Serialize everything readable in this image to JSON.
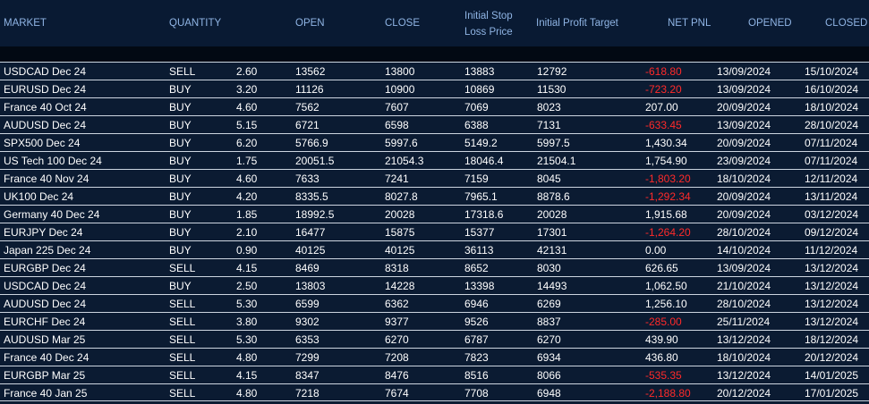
{
  "columns": {
    "market": "MARKET",
    "quantity": "QUANTITY",
    "open": "OPEN",
    "close": "CLOSE",
    "stop_line1": "Initial Stop",
    "stop_line2": "Loss Price",
    "profit": "Initial Profit Target",
    "pnl": "NET PNL",
    "opened": "OPENED",
    "closed": "CLOSED"
  },
  "colors": {
    "header_text": "#8fb4e4",
    "negative": "#ff2a2a",
    "text": "#ffffff"
  },
  "rows": [
    {
      "market": "USDCAD Dec 24",
      "side": "SELL",
      "qty": "2.60",
      "open": "13562",
      "close": "13800",
      "stop": "13883",
      "target": "12792",
      "pnl": "-618.80",
      "opened": "13/09/2024",
      "closed": "15/10/2024"
    },
    {
      "market": "EURUSD Dec 24",
      "side": "BUY",
      "qty": "3.20",
      "open": "11126",
      "close": "10900",
      "stop": "10869",
      "target": "11530",
      "pnl": "-723.20",
      "opened": "13/09/2024",
      "closed": "16/10/2024"
    },
    {
      "market": "France 40 Oct 24",
      "side": "BUY",
      "qty": "4.60",
      "open": "7562",
      "close": "7607",
      "stop": "7069",
      "target": "8023",
      "pnl": "207.00",
      "opened": "20/09/2024",
      "closed": "18/10/2024"
    },
    {
      "market": "AUDUSD Dec 24",
      "side": "BUY",
      "qty": "5.15",
      "open": "6721",
      "close": "6598",
      "stop": "6388",
      "target": "7131",
      "pnl": "-633.45",
      "opened": "13/09/2024",
      "closed": "28/10/2024"
    },
    {
      "market": "SPX500 Dec 24",
      "side": "BUY",
      "qty": "6.20",
      "open": "5766.9",
      "close": "5997.6",
      "stop": "5149.2",
      "target": "5997.5",
      "pnl": "1,430.34",
      "opened": "20/09/2024",
      "closed": "07/11/2024"
    },
    {
      "market": "US Tech 100 Dec 24",
      "side": "BUY",
      "qty": "1.75",
      "open": "20051.5",
      "close": "21054.3",
      "stop": "18046.4",
      "target": "21504.1",
      "pnl": "1,754.90",
      "opened": "23/09/2024",
      "closed": "07/11/2024"
    },
    {
      "market": "France 40 Nov 24",
      "side": "BUY",
      "qty": "4.60",
      "open": "7633",
      "close": "7241",
      "stop": "7159",
      "target": "8045",
      "pnl": "-1,803.20",
      "opened": "18/10/2024",
      "closed": "12/11/2024"
    },
    {
      "market": "UK100 Dec 24",
      "side": "BUY",
      "qty": "4.20",
      "open": "8335.5",
      "close": "8027.8",
      "stop": "7965.1",
      "target": "8878.6",
      "pnl": "-1,292.34",
      "opened": "20/09/2024",
      "closed": "13/11/2024"
    },
    {
      "market": "Germany 40 Dec 24",
      "side": "BUY",
      "qty": "1.85",
      "open": "18992.5",
      "close": "20028",
      "stop": "17318.6",
      "target": "20028",
      "pnl": "1,915.68",
      "opened": "20/09/2024",
      "closed": "03/12/2024"
    },
    {
      "market": "EURJPY Dec 24",
      "side": "BUY",
      "qty": "2.10",
      "open": "16477",
      "close": "15875",
      "stop": "15377",
      "target": "17301",
      "pnl": "-1,264.20",
      "opened": "28/10/2024",
      "closed": "09/12/2024"
    },
    {
      "market": "Japan 225 Dec 24",
      "side": "BUY",
      "qty": "0.90",
      "open": "40125",
      "close": "40125",
      "stop": "36113",
      "target": "42131",
      "pnl": "0.00",
      "opened": "14/10/2024",
      "closed": "11/12/2024"
    },
    {
      "market": "EURGBP Dec 24",
      "side": "SELL",
      "qty": "4.15",
      "open": "8469",
      "close": "8318",
      "stop": "8652",
      "target": "8030",
      "pnl": "626.65",
      "opened": "13/09/2024",
      "closed": "13/12/2024"
    },
    {
      "market": "USDCAD Dec 24",
      "side": "BUY",
      "qty": "2.50",
      "open": "13803",
      "close": "14228",
      "stop": "13398",
      "target": "14493",
      "pnl": "1,062.50",
      "opened": "21/10/2024",
      "closed": "13/12/2024"
    },
    {
      "market": "AUDUSD Dec 24",
      "side": "SELL",
      "qty": "5.30",
      "open": "6599",
      "close": "6362",
      "stop": "6946",
      "target": "6269",
      "pnl": "1,256.10",
      "opened": "28/10/2024",
      "closed": "13/12/2024"
    },
    {
      "market": "EURCHF Dec 24",
      "side": "SELL",
      "qty": "3.80",
      "open": "9302",
      "close": "9377",
      "stop": "9526",
      "target": "8837",
      "pnl": "-285.00",
      "opened": "25/11/2024",
      "closed": "13/12/2024"
    },
    {
      "market": "AUDUSD Mar 25",
      "side": "SELL",
      "qty": "5.30",
      "open": "6353",
      "close": "6270",
      "stop": "6787",
      "target": "6270",
      "pnl": "439.90",
      "opened": "13/12/2024",
      "closed": "18/12/2024"
    },
    {
      "market": "France 40 Dec 24",
      "side": "SELL",
      "qty": "4.80",
      "open": "7299",
      "close": "7208",
      "stop": "7823",
      "target": "6934",
      "pnl": "436.80",
      "opened": "18/10/2024",
      "closed": "20/12/2024"
    },
    {
      "market": "EURGBP Mar 25",
      "side": "SELL",
      "qty": "4.15",
      "open": "8347",
      "close": "8476",
      "stop": "8516",
      "target": "8066",
      "pnl": "-535.35",
      "opened": "13/12/2024",
      "closed": "14/01/2025"
    },
    {
      "market": "France 40 Jan 25",
      "side": "SELL",
      "qty": "4.80",
      "open": "7218",
      "close": "7674",
      "stop": "7708",
      "target": "6948",
      "pnl": "-2,188.80",
      "opened": "20/12/2024",
      "closed": "17/01/2025"
    }
  ]
}
